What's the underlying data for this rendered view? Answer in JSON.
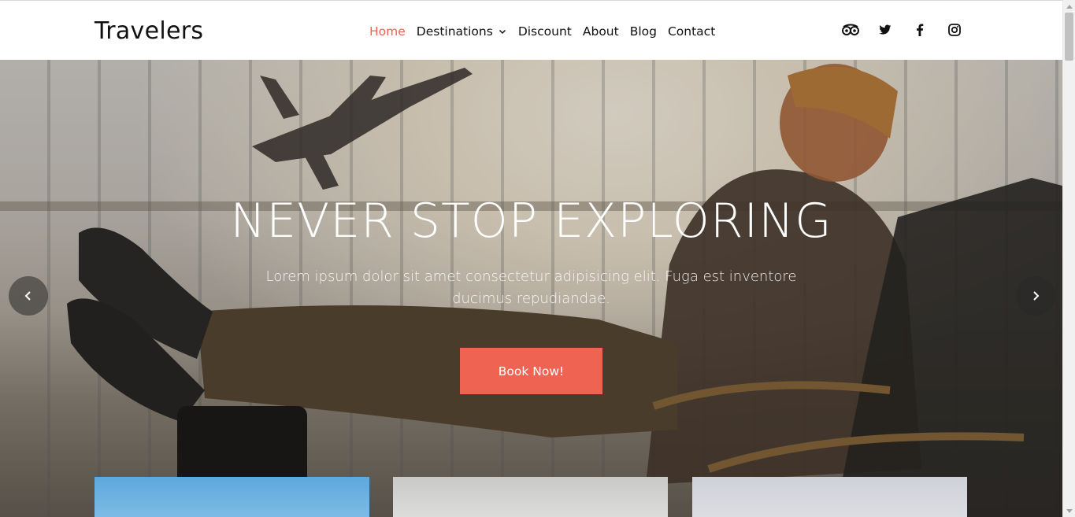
{
  "header": {
    "logo": "Travelers",
    "nav": [
      {
        "label": "Home",
        "active": true
      },
      {
        "label": "Destinations",
        "dropdown": true
      },
      {
        "label": "Discount"
      },
      {
        "label": "About"
      },
      {
        "label": "Blog"
      },
      {
        "label": "Contact"
      }
    ],
    "socials": [
      "tripadvisor-icon",
      "twitter-icon",
      "facebook-icon",
      "instagram-icon"
    ]
  },
  "hero": {
    "title": "NEVER STOP EXPLORING",
    "subtitle": "Lorem ipsum dolor sit amet consectetur adipisicing elit. Fuga est inventore ducimus repudiandae.",
    "button_label": "Book Now!"
  },
  "colors": {
    "accent": "#ee6352",
    "text": "#111111",
    "header_bg": "#ffffff"
  }
}
